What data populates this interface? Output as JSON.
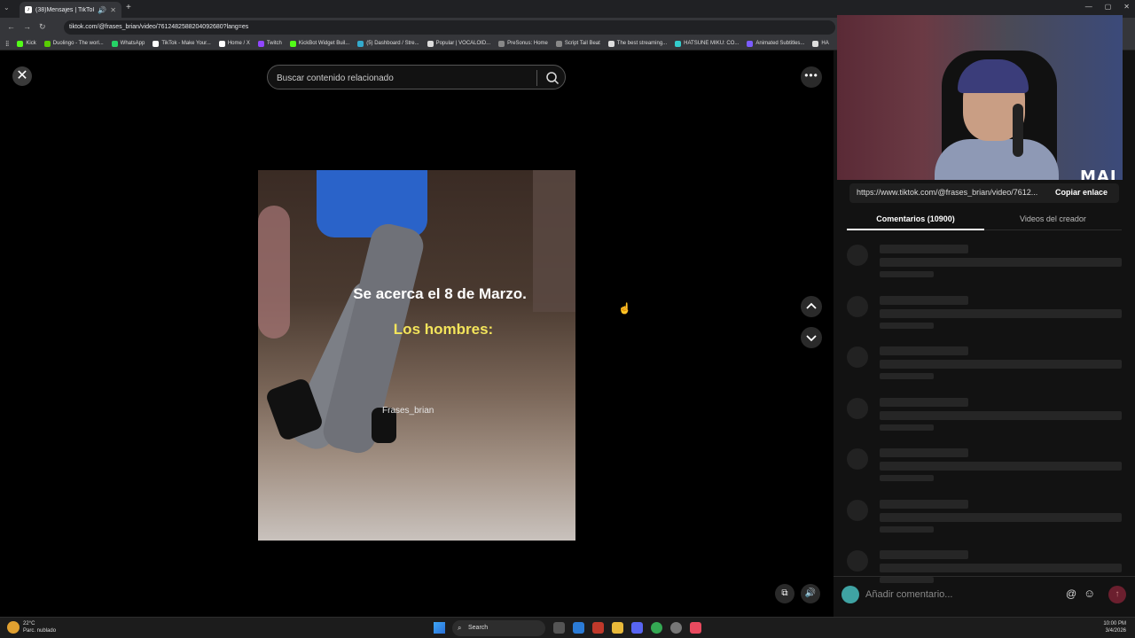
{
  "browser": {
    "tab_title": "(38)Mensajes | TikTok",
    "url": "tiktok.com/@frases_brian/video/7612482588204092680?lang=es",
    "bookmarks": [
      {
        "label": "Kick",
        "color": "#53fc18"
      },
      {
        "label": "Duolingo - The worl...",
        "color": "#58cc02"
      },
      {
        "label": "WhatsApp",
        "color": "#25d366"
      },
      {
        "label": "TikTok - Make Your...",
        "color": "#ffffff"
      },
      {
        "label": "Home / X",
        "color": "#ffffff"
      },
      {
        "label": "Twitch",
        "color": "#9146ff"
      },
      {
        "label": "KickBot Widget Buil...",
        "color": "#53fc18"
      },
      {
        "label": "(5) Dashboard / Stre...",
        "color": "#3ac"
      },
      {
        "label": "Popular | VOCALOID...",
        "color": "#ddd"
      },
      {
        "label": "PreSonus: Home",
        "color": "#888"
      },
      {
        "label": "Script Tail Beat",
        "color": "#888"
      },
      {
        "label": "The best streaming...",
        "color": "#ddd"
      },
      {
        "label": "HATSUNE MIKU: CO...",
        "color": "#3cc"
      },
      {
        "label": "Animated Subtitles...",
        "color": "#7b5cff"
      },
      {
        "label": "HA",
        "color": "#ddd"
      }
    ]
  },
  "video": {
    "search_placeholder": "Buscar contenido relacionado",
    "caption_line1": "Se acerca el 8 de Marzo.",
    "caption_line2": "Los hombres:",
    "watermark": "Frases_brian"
  },
  "webcam": {
    "logo_text": "MAI"
  },
  "side_panel": {
    "share_link": "https://www.tiktok.com/@frases_brian/video/7612...",
    "copy_label": "Copiar enlace",
    "tab_comments": "Comentarios (10900)",
    "tab_creator_videos": "Videos del creador",
    "comment_placeholder": "Añadir comentario..."
  },
  "taskbar": {
    "weather_temp": "22°C",
    "weather_desc": "Parc. nublado",
    "search_label": "Search",
    "time": "10:00 PM",
    "date": "3/4/2026"
  },
  "colors": {
    "caption_yellow": "#f3e45b",
    "accent_send": "#6b1f2e"
  }
}
